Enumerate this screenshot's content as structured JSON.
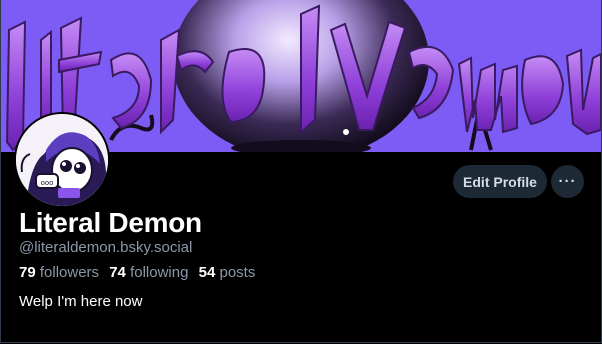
{
  "banner": {
    "artwork_text": "Literal Demon",
    "colors": {
      "background": "#7d5cf5",
      "lettering": "#9b4fe0",
      "orb": "#1a1420"
    }
  },
  "avatar": {
    "icon": "demon-character-avatar"
  },
  "profile": {
    "display_name": "Literal Demon",
    "handle": "@literaldemon.bsky.social",
    "bio": "Welp I'm here now"
  },
  "stats": {
    "followers_count": "79",
    "followers_label": "followers",
    "following_count": "74",
    "following_label": "following",
    "posts_count": "54",
    "posts_label": "posts"
  },
  "actions": {
    "edit_profile_label": "Edit Profile",
    "more_icon": "ellipsis-icon",
    "more_label": "···"
  },
  "theme": {
    "page_background": "#000000",
    "button_background": "#1e2936",
    "muted_text": "#8b98a8",
    "primary_text": "#ffffff"
  }
}
